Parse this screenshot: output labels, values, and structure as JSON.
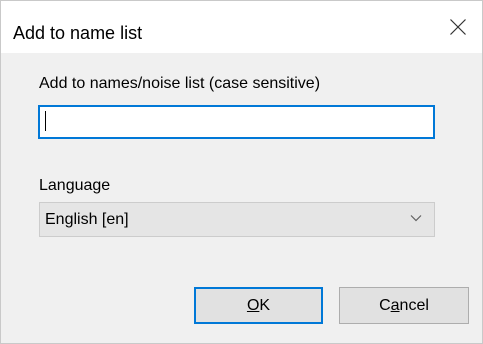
{
  "dialog": {
    "title": "Add to name list",
    "close_icon": "close-icon"
  },
  "name_field": {
    "label": "Add to names/noise list (case sensitive)",
    "value": "",
    "placeholder": ""
  },
  "language": {
    "label": "Language",
    "selected": "English [en]",
    "dropdown_icon": "chevron-down-icon"
  },
  "buttons": {
    "ok": {
      "before": "",
      "accel": "O",
      "after": "K"
    },
    "cancel": {
      "before": "C",
      "accel": "a",
      "after": "ncel"
    }
  },
  "colors": {
    "focus_accent": "#0078d7",
    "dialog_background": "#f0f0f0",
    "button_face": "#e1e1e1"
  }
}
